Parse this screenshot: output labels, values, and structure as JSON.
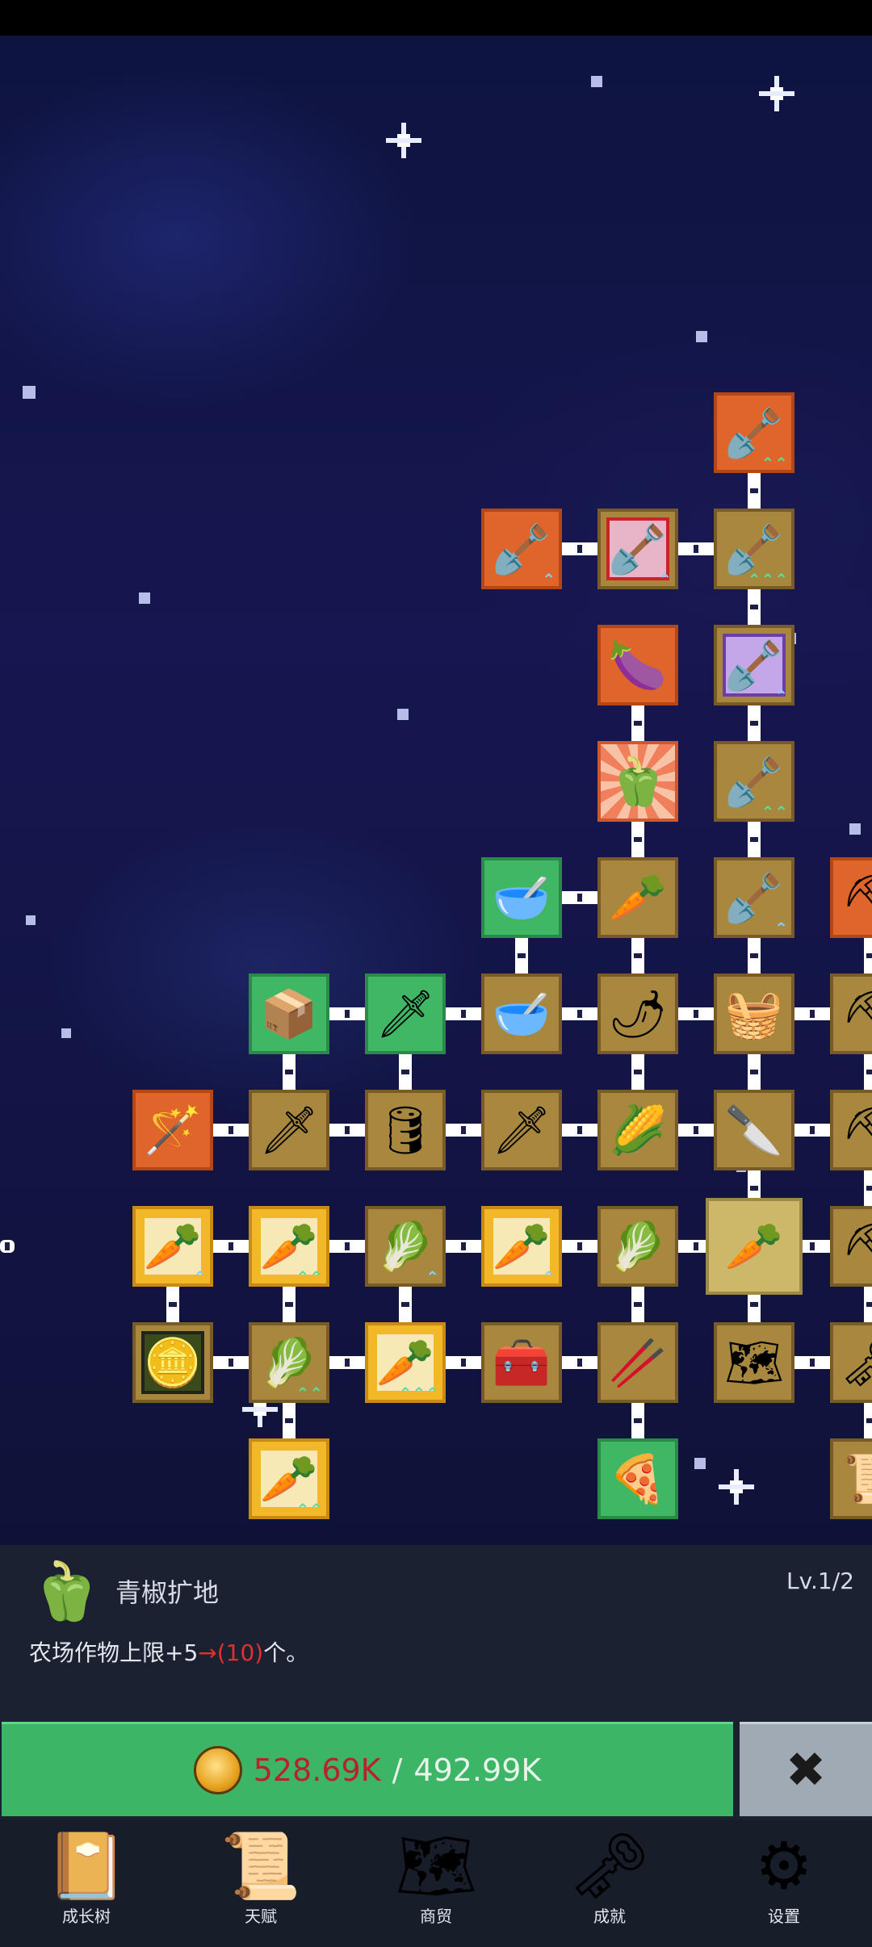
{
  "skill_tree": {
    "nodes": [
      {
        "id": "n1",
        "icon": "shovel-icon",
        "glyph": "🪏",
        "style": "orange",
        "arrow": "⌃⌃"
      },
      {
        "id": "n2",
        "icon": "shovel-icon",
        "glyph": "🪏",
        "style": "orange",
        "arrow": "⌃"
      },
      {
        "id": "n3",
        "icon": "shovel-icon",
        "glyph": "🪏",
        "style": "red-frame",
        "arrow": "⌃"
      },
      {
        "id": "n4",
        "icon": "shovel-icon",
        "glyph": "🪏",
        "style": "tan",
        "arrow": "⌃⌃⌃"
      },
      {
        "id": "n5",
        "icon": "eggplant-icon",
        "glyph": "🍆",
        "style": "orange"
      },
      {
        "id": "n6",
        "icon": "shovel-icon",
        "glyph": "🪏",
        "style": "purple-frame",
        "arrow": "⌃"
      },
      {
        "id": "n7",
        "icon": "bell-pepper-icon",
        "glyph": "🫑",
        "style": "burst"
      },
      {
        "id": "n8",
        "icon": "shovel-icon",
        "glyph": "🪏",
        "style": "tan",
        "arrow": "⌃⌃"
      },
      {
        "id": "n9",
        "icon": "bowl-icon",
        "glyph": "🥣",
        "style": "green"
      },
      {
        "id": "n10",
        "icon": "radish-icon",
        "glyph": "🥕",
        "style": "tan"
      },
      {
        "id": "n11",
        "icon": "shovel-icon",
        "glyph": "🪏",
        "style": "tan",
        "arrow": "⌃"
      },
      {
        "id": "n12",
        "icon": "pickaxe-icon",
        "glyph": "⛏",
        "style": "orange",
        "arrow": "⌃⌃"
      },
      {
        "id": "n13",
        "icon": "crate-icon",
        "glyph": "📦",
        "style": "green"
      },
      {
        "id": "n14",
        "icon": "sword-icon",
        "glyph": "🗡",
        "style": "green"
      },
      {
        "id": "n15",
        "icon": "bowl-icon",
        "glyph": "🥣",
        "style": "tan"
      },
      {
        "id": "n16",
        "icon": "chili-icon",
        "glyph": "🌶",
        "style": "tan"
      },
      {
        "id": "n17",
        "icon": "basket-icon",
        "glyph": "🧺",
        "style": "tan"
      },
      {
        "id": "n18",
        "icon": "pickaxe-icon",
        "glyph": "⛏",
        "style": "tan"
      },
      {
        "id": "n19",
        "icon": "wand-icon",
        "glyph": "🪄",
        "style": "orange"
      },
      {
        "id": "n20",
        "icon": "sword-icon",
        "glyph": "🗡",
        "style": "tan"
      },
      {
        "id": "n21",
        "icon": "barrel-icon",
        "glyph": "🛢",
        "style": "tan"
      },
      {
        "id": "n22",
        "icon": "sword-icon",
        "glyph": "🗡",
        "style": "tan"
      },
      {
        "id": "n23",
        "icon": "corn-icon",
        "glyph": "🌽",
        "style": "tan"
      },
      {
        "id": "n24",
        "icon": "knife-icon",
        "glyph": "🔪",
        "style": "tan"
      },
      {
        "id": "n25",
        "icon": "pickaxe-icon",
        "glyph": "⛏",
        "style": "tan",
        "arrow": "⌃"
      },
      {
        "id": "n26",
        "icon": "carrot-icon",
        "glyph": "🥕",
        "style": "gold",
        "arrow": "⌃"
      },
      {
        "id": "n27",
        "icon": "carrot-icon",
        "glyph": "🥕",
        "style": "gold",
        "arrow": "⌃⌃"
      },
      {
        "id": "n28",
        "icon": "cabbage-icon",
        "glyph": "🥬",
        "style": "tan",
        "arrow": "⌃"
      },
      {
        "id": "n29",
        "icon": "carrot-icon",
        "glyph": "🥕",
        "style": "gold",
        "arrow": "⌃"
      },
      {
        "id": "n30",
        "icon": "cabbage-icon",
        "glyph": "🥬",
        "style": "tan"
      },
      {
        "id": "n31",
        "icon": "carrot-icon",
        "glyph": "🥕",
        "style": "selected"
      },
      {
        "id": "n32",
        "icon": "pickaxe-icon",
        "glyph": "⛏",
        "style": "tan"
      },
      {
        "id": "n33",
        "icon": "coin-icon",
        "glyph": "🪙",
        "style": "coin-frame"
      },
      {
        "id": "n34",
        "icon": "cabbage-icon",
        "glyph": "🥬",
        "style": "tan",
        "arrow": "⌃⌃"
      },
      {
        "id": "n35",
        "icon": "carrot-icon",
        "glyph": "🥕",
        "style": "gold",
        "arrow": "⌃⌃⌃"
      },
      {
        "id": "n36",
        "icon": "treasure-chest-icon",
        "glyph": "🧰",
        "style": "tan"
      },
      {
        "id": "n37",
        "icon": "leek-icon",
        "glyph": "🥢",
        "style": "tan"
      },
      {
        "id": "n38",
        "icon": "map-icon",
        "glyph": "🗺",
        "style": "tan"
      },
      {
        "id": "n39",
        "icon": "key-icon",
        "glyph": "🗝",
        "style": "tan"
      },
      {
        "id": "n40",
        "icon": "carrot-icon",
        "glyph": "🥕",
        "style": "gold",
        "arrow": "⌃⌃"
      },
      {
        "id": "n41",
        "icon": "pizza-icon",
        "glyph": "🍕",
        "style": "green"
      },
      {
        "id": "n42",
        "icon": "scroll-icon",
        "glyph": "📜",
        "style": "tan"
      }
    ]
  },
  "info_panel": {
    "icon": "bell-pepper-icon",
    "glyph": "🫑",
    "title": "青椒扩地",
    "level": "Lv.1/2",
    "desc_prefix": "农场作物上限+5",
    "desc_highlight": "→(10)",
    "desc_suffix": "个。"
  },
  "purchase": {
    "coin_icon": "gold-coin-icon",
    "current": "528.69K",
    "separator": "/",
    "cost": "492.99K",
    "close_glyph": "✖"
  },
  "bottom_nav": [
    {
      "label": "成长树",
      "icon": "book-icon",
      "glyph": "📔"
    },
    {
      "label": "天赋",
      "icon": "scroll-icon",
      "glyph": "📜"
    },
    {
      "label": "商贸",
      "icon": "map-icon",
      "glyph": "🗺"
    },
    {
      "label": "成就",
      "icon": "key-icon",
      "glyph": "🗝"
    },
    {
      "label": "设置",
      "icon": "gear-icon",
      "glyph": "⚙"
    }
  ],
  "colors": {
    "tan": "#a8873e",
    "orange": "#e0652a",
    "green": "#3fb764",
    "gold": "#f3b72a",
    "buy_button": "#3cb567",
    "price_red": "#b8222a"
  }
}
